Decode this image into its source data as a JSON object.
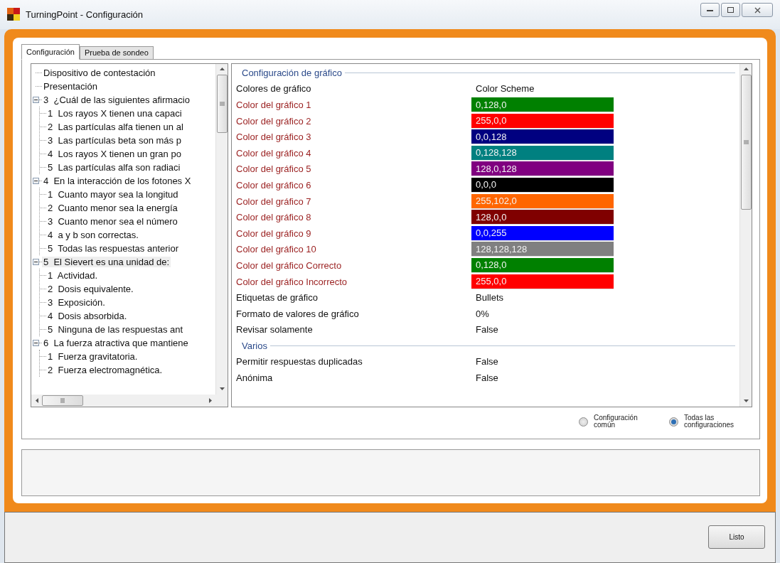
{
  "window": {
    "title": "TurningPoint - Configuración"
  },
  "tabs": [
    {
      "label": "Configuración",
      "selected": true
    },
    {
      "label": "Prueba de sondeo",
      "selected": false
    }
  ],
  "tree": [
    {
      "label": "Dispositivo de contestación",
      "selected": false
    },
    {
      "label": "Presentación",
      "selected": false
    },
    {
      "label": "3  ¿Cuál de las siguientes afirmacio",
      "selected": false,
      "expanded": true,
      "children": [
        {
          "label": "1  Los rayos X tienen una capaci",
          "selected": false
        },
        {
          "label": "2  Las partículas alfa tienen un al",
          "selected": false
        },
        {
          "label": "3  Las partículas beta son más p",
          "selected": false
        },
        {
          "label": "4  Los rayos X tienen un gran po",
          "selected": false
        },
        {
          "label": "5  Las partículas alfa son radiaci",
          "selected": false
        }
      ]
    },
    {
      "label": "4  En la interacción de los fotones X",
      "selected": false,
      "expanded": true,
      "children": [
        {
          "label": "1  Cuanto mayor sea la longitud",
          "selected": false
        },
        {
          "label": "2  Cuanto menor sea la energía",
          "selected": false
        },
        {
          "label": "3  Cuanto menor sea el número",
          "selected": false
        },
        {
          "label": "4  a y b son correctas.",
          "selected": false
        },
        {
          "label": "5  Todas las respuestas anterior",
          "selected": false
        }
      ]
    },
    {
      "label": "5  El Sievert es una unidad de:",
      "selected": true,
      "expanded": true,
      "children": [
        {
          "label": "1  Actividad.",
          "selected": false
        },
        {
          "label": "2  Dosis equivalente.",
          "selected": false
        },
        {
          "label": "3  Exposición.",
          "selected": false
        },
        {
          "label": "4  Dosis absorbida.",
          "selected": false
        },
        {
          "label": "5  Ninguna de las respuestas ant",
          "selected": false
        }
      ]
    },
    {
      "label": "6  La fuerza atractiva que mantiene",
      "selected": false,
      "expanded": true,
      "children": [
        {
          "label": "1  Fuerza gravitatoria.",
          "selected": false
        },
        {
          "label": "2  Fuerza electromagnética.",
          "selected": false
        }
      ]
    }
  ],
  "properties": [
    {
      "section": "Configuración de gráfico",
      "rows": [
        {
          "kind": "text",
          "name": "Colores de gráfico",
          "value": "Color Scheme"
        },
        {
          "kind": "color",
          "name": "Color del gráfico 1",
          "value": "0,128,0",
          "color": "#008000"
        },
        {
          "kind": "color",
          "name": "Color del gráfico 2",
          "value": "255,0,0",
          "color": "#ff0000"
        },
        {
          "kind": "color",
          "name": "Color del gráfico 3",
          "value": "0,0,128",
          "color": "#000080"
        },
        {
          "kind": "color",
          "name": "Color del gráfico 4",
          "value": "0,128,128",
          "color": "#008080"
        },
        {
          "kind": "color",
          "name": "Color del gráfico 5",
          "value": "128,0,128",
          "color": "#800080"
        },
        {
          "kind": "color",
          "name": "Color del gráfico 6",
          "value": "0,0,0",
          "color": "#000000"
        },
        {
          "kind": "color",
          "name": "Color del gráfico 7",
          "value": "255,102,0",
          "color": "#ff6600"
        },
        {
          "kind": "color",
          "name": "Color del gráfico 8",
          "value": "128,0,0",
          "color": "#800000"
        },
        {
          "kind": "color",
          "name": "Color del gráfico 9",
          "value": "0,0,255",
          "color": "#0000ff"
        },
        {
          "kind": "color",
          "name": "Color del gráfico 10",
          "value": "128,128,128",
          "color": "#808080"
        },
        {
          "kind": "color",
          "name": "Color del gráfico Correcto",
          "value": "0,128,0",
          "color": "#008000"
        },
        {
          "kind": "color",
          "name": "Color del gráfico Incorrecto",
          "value": "255,0,0",
          "color": "#ff0000"
        },
        {
          "kind": "text",
          "name": "Etiquetas de gráfico",
          "value": "Bullets"
        },
        {
          "kind": "text",
          "name": "Formato de valores de gráfico",
          "value": "0%"
        },
        {
          "kind": "text",
          "name": "Revisar solamente",
          "value": "False"
        }
      ]
    },
    {
      "section": "Varios",
      "rows": [
        {
          "kind": "text",
          "name": "Permitir respuestas duplicadas",
          "value": "False"
        },
        {
          "kind": "text",
          "name": "Anónima",
          "value": "False"
        }
      ]
    }
  ],
  "scope": [
    {
      "label": "Configuración común",
      "selected": false
    },
    {
      "label": "Todas las configuraciones",
      "selected": true
    }
  ],
  "buttons": [
    {
      "label": "Listo"
    }
  ]
}
